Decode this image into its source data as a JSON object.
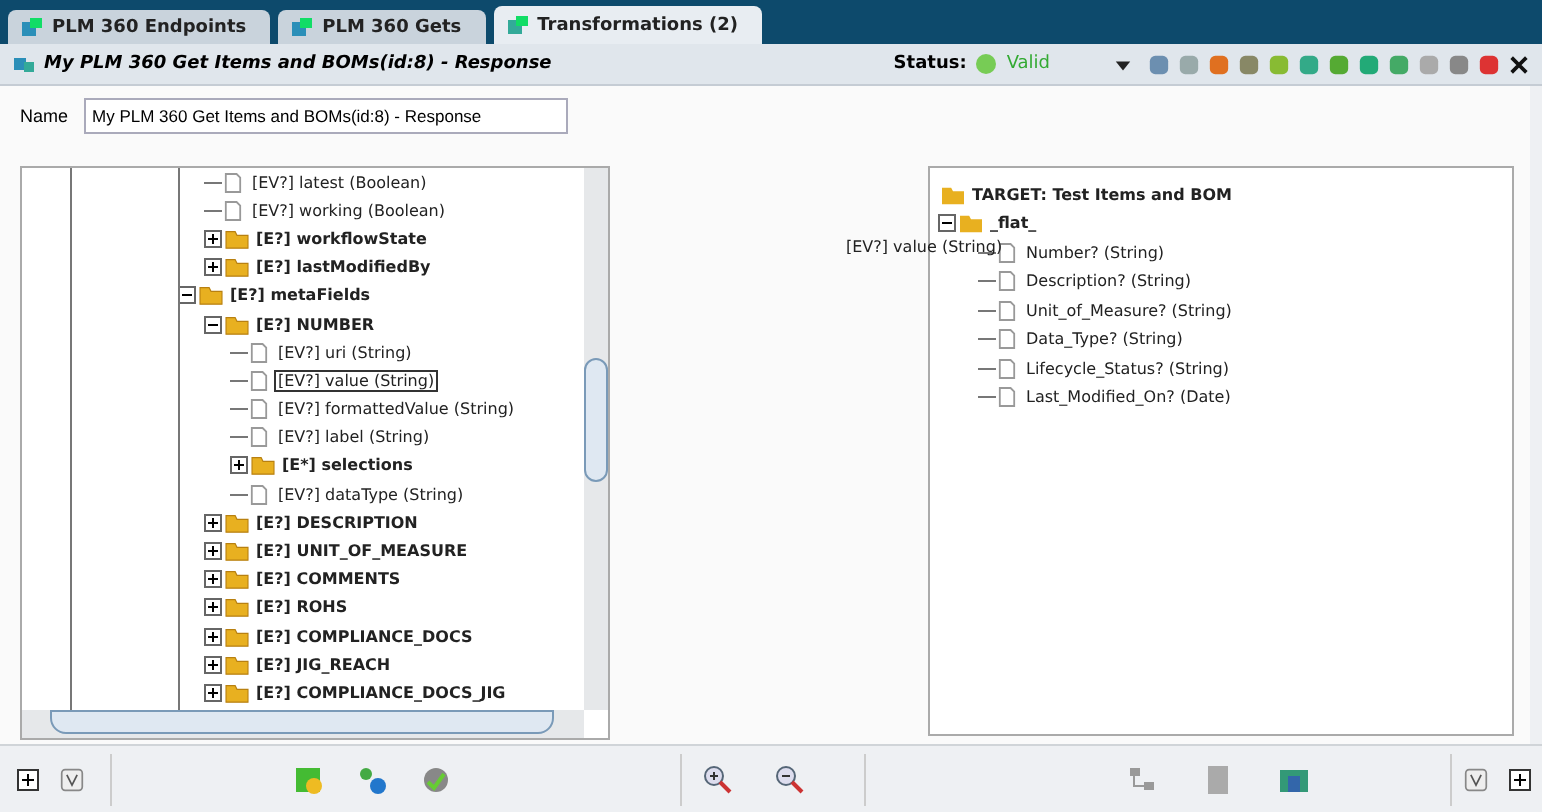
{
  "tabs": [
    {
      "label": "PLM 360 Endpoints",
      "selected": false
    },
    {
      "label": "PLM 360 Gets",
      "selected": false
    },
    {
      "label": "Transformations (2)",
      "selected": true
    }
  ],
  "header": {
    "title": "My PLM 360 Get Items and BOMs(id:8) - Response",
    "status_label": "Status:",
    "status": "Valid"
  },
  "name_field": {
    "label": "Name",
    "value": "My PLM 360 Get Items and BOMs(id:8) - Response"
  },
  "source_tree": [
    {
      "kind": "group",
      "children": [
        {
          "kind": "leaf",
          "label": "[EV?] latest  (Boolean)",
          "selected": false
        },
        {
          "kind": "leaf",
          "label": "[EV?] working  (Boolean)",
          "selected": false
        },
        {
          "kind": "folder",
          "label": "[E?] workflowState",
          "expanded": false,
          "selected": false
        },
        {
          "kind": "folder",
          "label": "[E?] lastModifiedBy",
          "expanded": false,
          "selected": false
        }
      ]
    },
    {
      "kind": "folder",
      "label": "[E?] metaFields",
      "expanded": true,
      "selected": false,
      "children": [
        {
          "kind": "folder",
          "label": "[E?] NUMBER",
          "expanded": true,
          "selected": false,
          "children": [
            {
              "kind": "leaf",
              "label": "[EV?] uri  (String)",
              "selected": false
            },
            {
              "kind": "leaf",
              "label": "[EV?] value  (String)",
              "selected": true
            },
            {
              "kind": "leaf",
              "label": "[EV?] formattedValue  (String)",
              "selected": false
            },
            {
              "kind": "leaf",
              "label": "[EV?] label  (String)",
              "selected": false
            },
            {
              "kind": "folder",
              "label": "[E*] selections",
              "expanded": false,
              "selected": false
            },
            {
              "kind": "leaf",
              "label": "[EV?] dataType  (String)",
              "selected": false
            }
          ]
        },
        {
          "kind": "folder",
          "label": "[E?] DESCRIPTION",
          "expanded": false,
          "selected": false
        },
        {
          "kind": "folder",
          "label": "[E?] UNIT_OF_MEASURE",
          "expanded": false,
          "selected": false
        },
        {
          "kind": "folder",
          "label": "[E?] COMMENTS",
          "expanded": false,
          "selected": false
        },
        {
          "kind": "folder",
          "label": "[E?] ROHS",
          "expanded": false,
          "selected": false
        },
        {
          "kind": "folder",
          "label": "[E?] COMPLIANCE_DOCS",
          "expanded": false,
          "selected": false
        },
        {
          "kind": "folder",
          "label": "[E?] JIG_REACH",
          "expanded": false,
          "selected": false
        },
        {
          "kind": "folder",
          "label": "[E?] COMPLIANCE_DOCS_JIG",
          "expanded": false,
          "selected": false
        }
      ]
    }
  ],
  "target_tree": {
    "root": "TARGET: Test Items and BOM",
    "group": "_flat_",
    "expanded": true,
    "fields": [
      "Number? (String)",
      "Description? (String)",
      "Unit_of_Measure? (String)",
      "Data_Type? (String)",
      "Lifecycle_Status? (String)",
      "Last_Modified_On? (Date)"
    ]
  },
  "drag_label": "[EV?] value  (String)"
}
